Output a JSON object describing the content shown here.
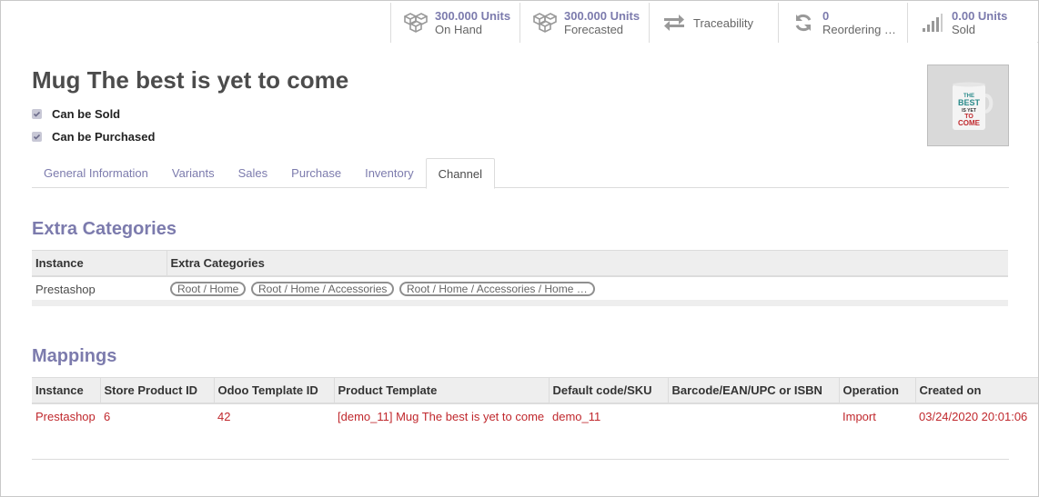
{
  "stat_buttons": [
    {
      "value": "300.000 Units",
      "label": "On Hand",
      "icon": "cubes-icon"
    },
    {
      "value": "300.000 Units",
      "label": "Forecasted",
      "icon": "cubes-icon"
    },
    {
      "label": "Traceability",
      "icon": "arrows-exchange-icon"
    },
    {
      "value": "0",
      "label": "Reordering …",
      "icon": "refresh-icon"
    },
    {
      "value": "0.00 Units",
      "label": "Sold",
      "icon": "signal-bars-icon"
    }
  ],
  "product": {
    "name": "Mug The best is yet to come",
    "can_be_sold": "Can be Sold",
    "can_be_purchased": "Can be Purchased",
    "image_text": [
      "THE",
      "BEST",
      "IS YET",
      "TO",
      "COME"
    ]
  },
  "tabs": [
    "General Information",
    "Variants",
    "Sales",
    "Purchase",
    "Inventory",
    "Channel"
  ],
  "active_tab": "Channel",
  "extra_categories": {
    "title": "Extra Categories",
    "columns": [
      "Instance",
      "Extra Categories"
    ],
    "rows": [
      {
        "instance": "Prestashop",
        "tags": [
          "Root / Home",
          "Root / Home / Accessories",
          "Root / Home / Accessories / Home …"
        ]
      }
    ]
  },
  "mappings": {
    "title": "Mappings",
    "columns": [
      "Instance",
      "Store Product ID",
      "Odoo Template ID",
      "Product Template",
      "Default code/SKU",
      "Barcode/EAN/UPC or ISBN",
      "Operation",
      "Created on"
    ],
    "rows": [
      {
        "instance": "Prestashop",
        "store_product_id": "6",
        "odoo_template_id": "42",
        "product_template": "[demo_11] Mug The best is yet to come",
        "default_code": "demo_11",
        "barcode": "",
        "operation": "Import",
        "created_on": "03/24/2020 20:01:06"
      }
    ]
  },
  "colors": {
    "accent": "#7c7bad",
    "link_red": "#c0282d",
    "header_bg": "#eeeeee"
  }
}
